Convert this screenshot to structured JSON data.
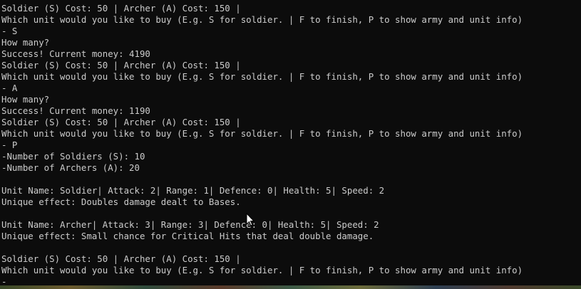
{
  "console": {
    "lines": [
      "Soldier (S) Cost: 50 | Archer (A) Cost: 150 |",
      "Which unit would you like to buy (E.g. S for soldier. | F to finish, P to show army and unit info)",
      "- S",
      "How many?",
      "Success! Current money: 4190",
      "Soldier (S) Cost: 50 | Archer (A) Cost: 150 |",
      "Which unit would you like to buy (E.g. S for soldier. | F to finish, P to show army and unit info)",
      "- A",
      "How many?",
      "Success! Current money: 1190",
      "Soldier (S) Cost: 50 | Archer (A) Cost: 150 |",
      "Which unit would you like to buy (E.g. S for soldier. | F to finish, P to show army and unit info)",
      "- P",
      "-Number of Soldiers (S): 10",
      "-Number of Archers (A): 20",
      "",
      "Unit Name: Soldier| Attack: 2| Range: 1| Defence: 0| Health: 5| Speed: 2",
      "Unique effect: Doubles damage dealt to Bases.",
      "",
      "Unit Name: Archer| Attack: 3| Range: 3| Defence: 0| Health: 5| Speed: 2",
      "Unique effect: Small chance for Critical Hits that deal double damage.",
      "",
      "Soldier (S) Cost: 50 | Archer (A) Cost: 150 |",
      "Which unit would you like to buy (E.g. S for soldier. | F to finish, P to show army and unit info)",
      "-"
    ]
  },
  "colors": {
    "background": "#0c0c0c",
    "text": "#cccccc"
  },
  "icons": {
    "cursor": "mouse-pointer-icon"
  }
}
